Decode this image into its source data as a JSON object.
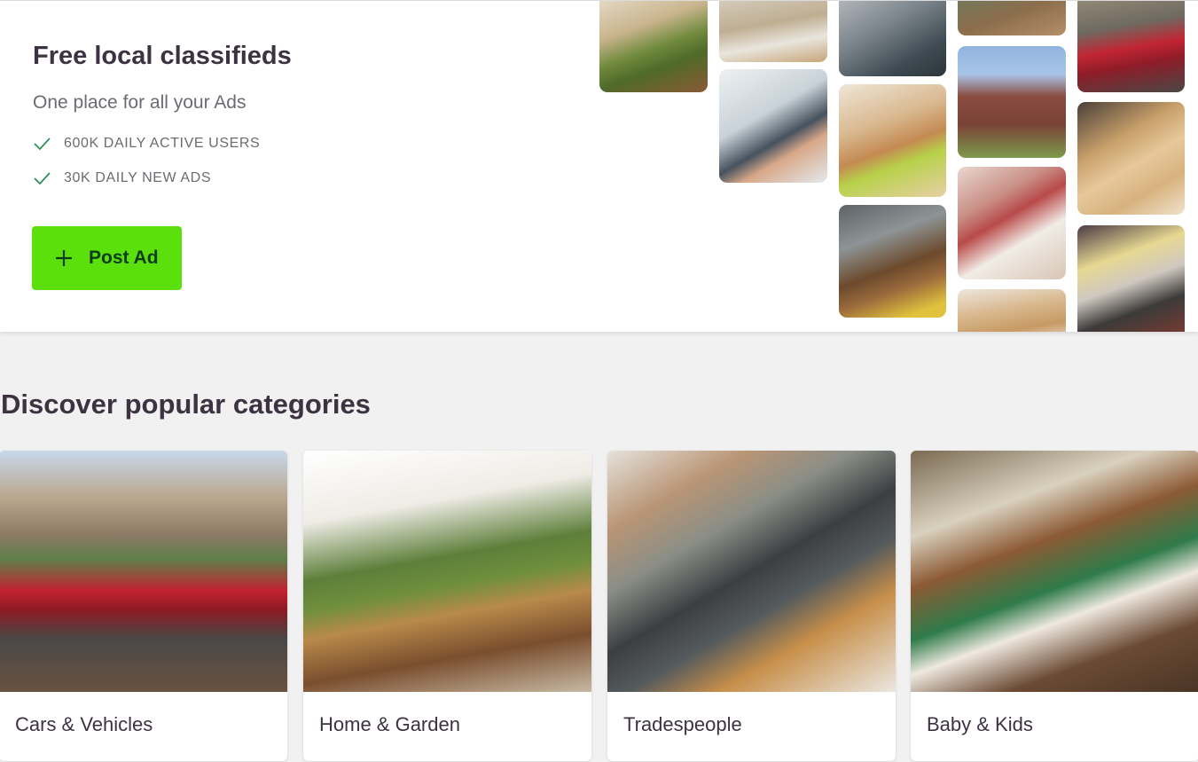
{
  "hero": {
    "title": "Free local classifieds",
    "subtitle": "One place for all your Ads",
    "stats": [
      "600K DAILY ACTIVE USERS",
      "30K DAILY NEW ADS"
    ],
    "post_button": {
      "label": "Post Ad",
      "icon": "plus-icon"
    },
    "mosaic_images": [
      "armchair",
      "living room",
      "laptop",
      "person",
      "red car",
      "handshake",
      "dog with tennis ball",
      "brick houses",
      "drilling wood",
      "plumber under sink",
      "clothes on rack",
      "tool belt",
      "shelves"
    ]
  },
  "categories": {
    "title": "Discover popular categories",
    "items": [
      {
        "label": "Cars & Vehicles",
        "image": "red car on street"
      },
      {
        "label": "Home & Garden",
        "image": "green armchair in living room"
      },
      {
        "label": "Tradespeople",
        "image": "tradesperson with toolbox"
      },
      {
        "label": "Baby & Kids",
        "image": "toy drum and baby clothes"
      }
    ]
  },
  "colors": {
    "accent_green": "#5ce00b",
    "button_text": "#0b3d1c",
    "check_green": "#2f8f5a",
    "heading": "#3c3241",
    "page_bg": "#f1f1f1"
  }
}
